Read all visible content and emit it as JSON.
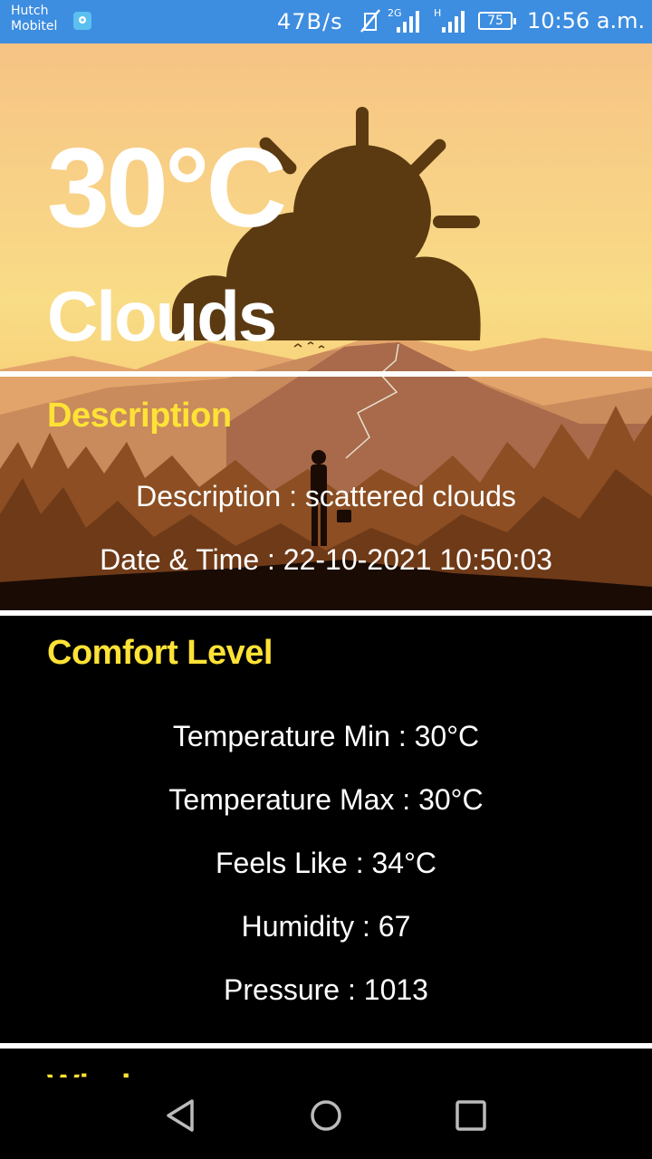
{
  "status_bar": {
    "carrier_line1": "Hutch",
    "carrier_line2": "Mobitel",
    "net_speed": "47B/s",
    "network_2g": "2G",
    "network_h": "H",
    "battery": "75",
    "time": "10:56 a.m."
  },
  "weather": {
    "temperature": "30°C",
    "condition": "Clouds",
    "icon": "cloud-sun-icon"
  },
  "description_section": {
    "title": "Description",
    "description_line": "Description : scattered clouds",
    "datetime_line": "Date & Time : 22-10-2021 10:50:03"
  },
  "comfort_section": {
    "title": "Comfort Level",
    "temp_min": "Temperature Min : 30°C",
    "temp_max": "Temperature Max : 30°C",
    "feels_like": "Feels Like : 34°C",
    "humidity": "Humidity : 67",
    "pressure": "Pressure : 1013"
  },
  "wind_section": {
    "title": "Wind"
  },
  "colors": {
    "accent_yellow": "#ffe236",
    "status_bar": "#3d8de0",
    "icon_brown": "#5b3a12"
  },
  "nav": {
    "back": "back-icon",
    "home": "home-icon",
    "recents": "recents-icon"
  }
}
